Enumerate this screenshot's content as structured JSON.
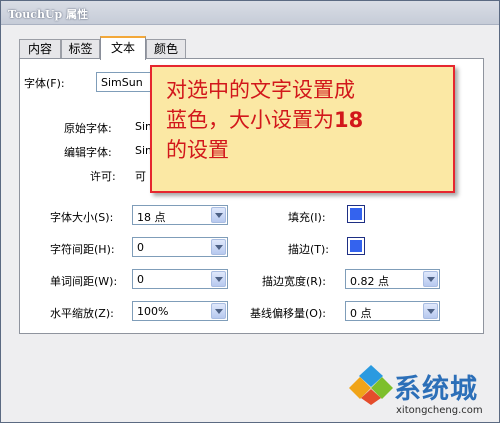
{
  "window": {
    "title": "TouchUp 属性"
  },
  "tabs": [
    {
      "label": "内容"
    },
    {
      "label": "标签"
    },
    {
      "label": "文本"
    },
    {
      "label": "颜色"
    }
  ],
  "font": {
    "label": "字体(F):",
    "value": "SimSun",
    "original_label": "原始字体:",
    "original_value": "Sim",
    "edit_label": "编辑字体:",
    "edit_value": "Sim",
    "permission_label": "许可:",
    "permission_value": "可"
  },
  "left_fields": [
    {
      "label": "字体大小(S):",
      "value": "18 点"
    },
    {
      "label": "字符间距(H):",
      "value": "0"
    },
    {
      "label": "单词间距(W):",
      "value": "0"
    },
    {
      "label": "水平缩放(Z):",
      "value": "100%"
    }
  ],
  "right_fields": {
    "fill_label": "填充(I):",
    "stroke_label": "描边(T):",
    "stroke_width_label": "描边宽度(R):",
    "stroke_width_value": "0.82 点",
    "baseline_label": "基线偏移量(O):",
    "baseline_value": "0 点"
  },
  "colors": {
    "fill": "#3463ee",
    "stroke": "#3463ee",
    "callout_text": "#d2171b",
    "callout_bg": "#fbe8a4"
  },
  "callout": {
    "line1": "对选中的文字设置成",
    "line2a": "蓝色，大小设置为",
    "line2b": "18",
    "line3": "的设置"
  },
  "watermark": {
    "brand": "系统城",
    "url": "xitongcheng.com"
  }
}
